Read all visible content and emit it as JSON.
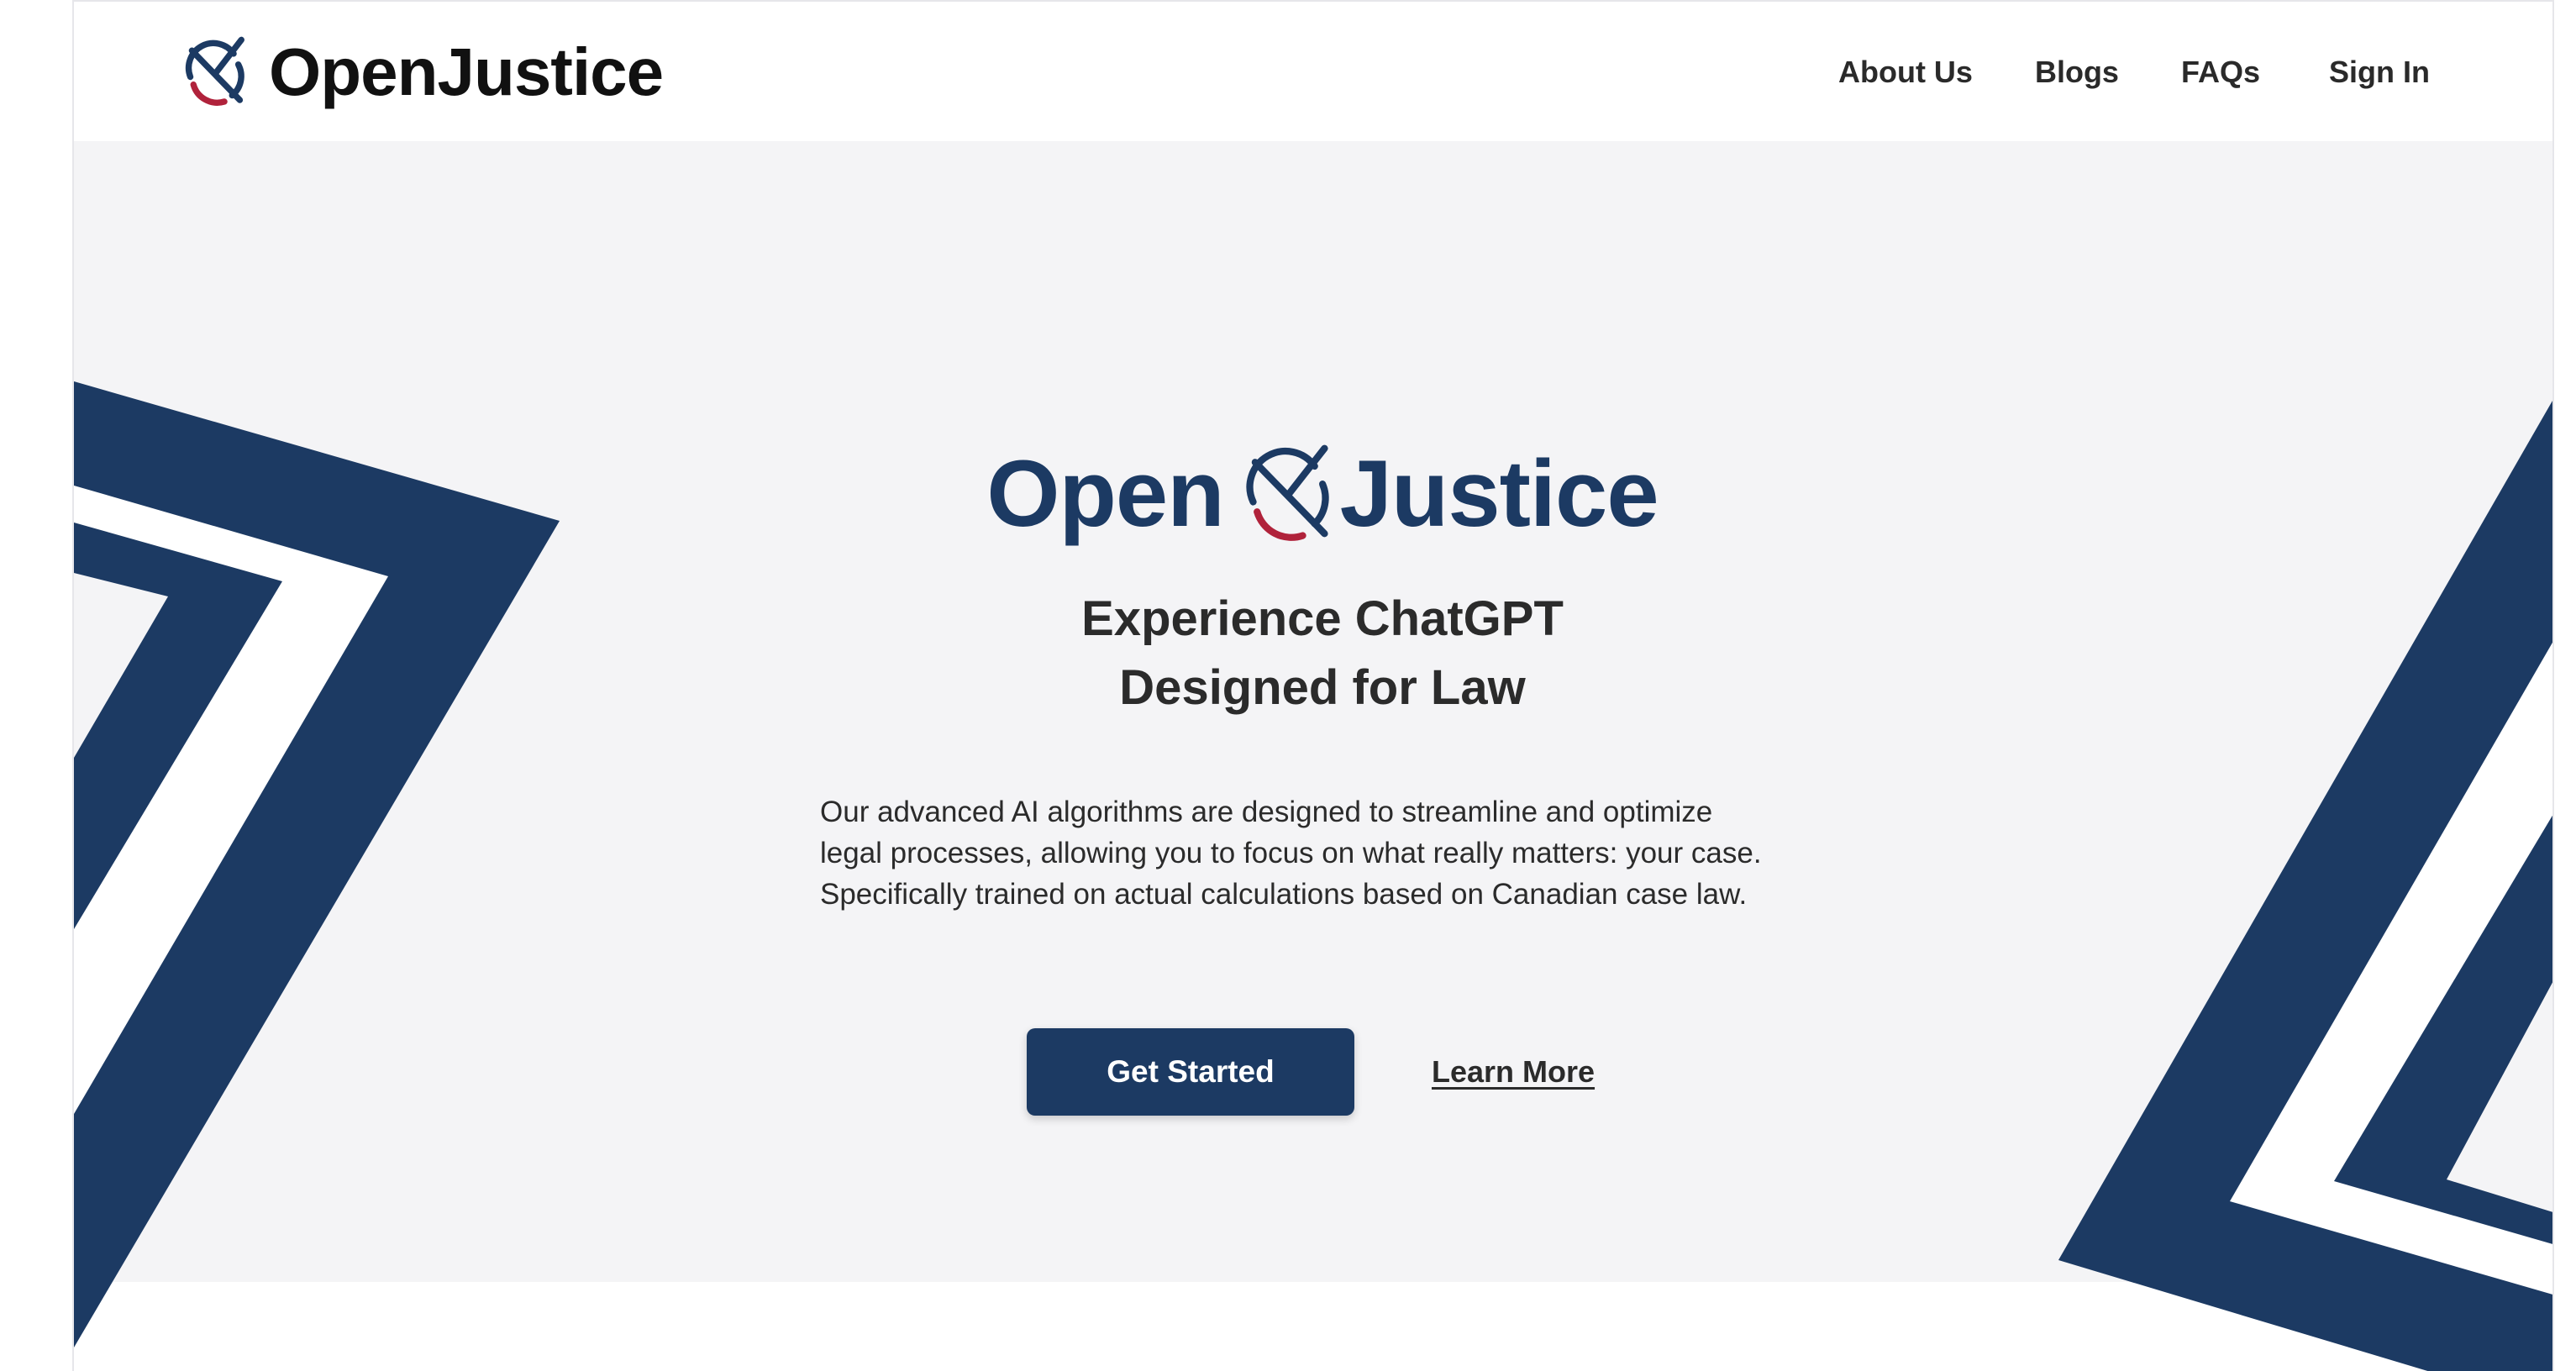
{
  "header": {
    "brand_name": "OpenJustice",
    "nav": [
      {
        "label": "About Us"
      },
      {
        "label": "Blogs"
      },
      {
        "label": "FAQs"
      },
      {
        "label": "Sign In"
      }
    ]
  },
  "hero": {
    "wordmark_left": "Open",
    "wordmark_right": "Justice",
    "headline_lines": [
      "Experience ChatGPT",
      "Designed for Law"
    ],
    "description_lines": [
      "Our advanced AI algorithms are designed to streamline and optimize",
      "legal processes, allowing you to focus on what really matters: your case.",
      "Specifically trained on actual calculations based on Canadian case law."
    ],
    "primary_cta": "Get Started",
    "secondary_cta": "Learn More"
  },
  "colors": {
    "brand_navy": "#1c3a63",
    "brand_red": "#b0223b",
    "hero_background": "#f4f4f6",
    "text_dark": "#2b2b2b"
  },
  "icons": {
    "brand_logo": "openjustice-logo-icon",
    "hero_logo": "openjustice-logo-icon"
  }
}
